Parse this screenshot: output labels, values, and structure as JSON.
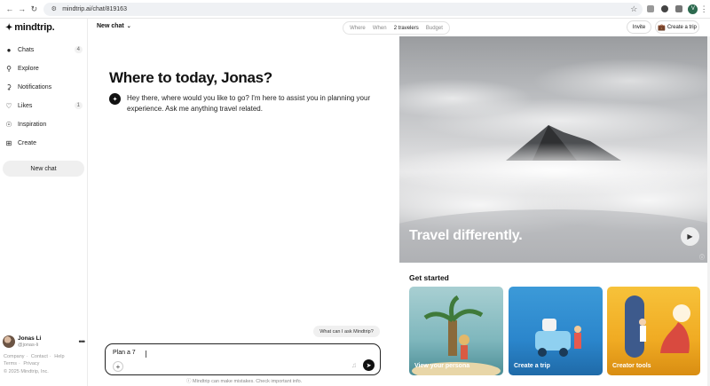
{
  "browser": {
    "url": "mindtrip.ai/chat/819163",
    "profile_initial": "V"
  },
  "brand": {
    "name": "mindtrip."
  },
  "sidebar": {
    "items": [
      {
        "label": "Chats",
        "icon": "chat-bubble-icon",
        "count": "4"
      },
      {
        "label": "Explore",
        "icon": "search-icon",
        "count": ""
      },
      {
        "label": "Notifications",
        "icon": "bell-icon",
        "count": ""
      },
      {
        "label": "Likes",
        "icon": "heart-icon",
        "count": "1"
      },
      {
        "label": "Inspiration",
        "icon": "compass-icon",
        "count": ""
      },
      {
        "label": "Create",
        "icon": "plus-square-icon",
        "count": ""
      }
    ],
    "new_chat_label": "New chat",
    "user": {
      "name": "Jonas Li",
      "handle": "@jonas-li"
    },
    "footer_links": [
      "Company",
      "Contact",
      "Help",
      "Terms",
      "Privacy"
    ],
    "copyright": "© 2025 Mindtrip, Inc."
  },
  "topbar": {
    "chat_dropdown": "New chat",
    "filters": [
      "Where",
      "When",
      "2 travelers",
      "Budget"
    ],
    "invite_label": "Invite",
    "create_trip_label": "Create a trip"
  },
  "chat": {
    "greeting": "Where to today, Jonas?",
    "bot_message": "Hey there, where would you like to go? I'm here to assist you in planning your experience. Ask me anything travel related.",
    "suggestion": "What can I ask Mindtrip?",
    "input_value": "Plan a 7",
    "disclaimer": "Mindtrip can make mistakes. Check important info."
  },
  "hero": {
    "title": "Travel differently."
  },
  "get_started": {
    "title": "Get started",
    "cards": [
      {
        "label": "View your persona"
      },
      {
        "label": "Create a trip"
      },
      {
        "label": "Creator tools"
      }
    ]
  },
  "colors": {
    "accent_dark": "#111111",
    "card_persona": "#7fb7bd",
    "card_trip": "#2b86cc",
    "card_creator": "#f0ab23"
  }
}
